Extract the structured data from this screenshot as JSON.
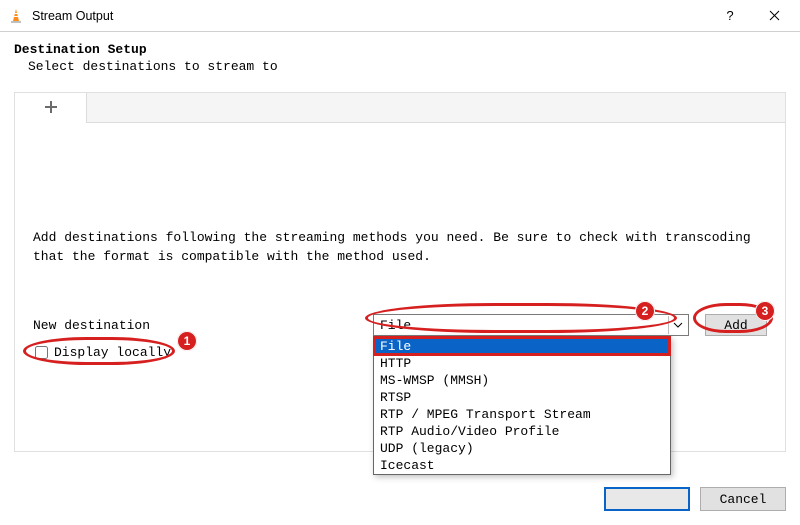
{
  "window": {
    "title": "Stream Output"
  },
  "header": {
    "title": "Destination Setup",
    "subtitle": "Select destinations to stream to"
  },
  "panel": {
    "instruction": "Add destinations following the streaming methods you need. Be sure to check with transcoding that the format is compatible with the method used.",
    "new_destination_label": "New destination",
    "combo_selected": "File",
    "add_label": "Add",
    "display_locally_label": "Display locally",
    "display_locally_checked": false
  },
  "dropdown_options": [
    "File",
    "HTTP",
    "MS-WMSP (MMSH)",
    "RTSP",
    "RTP / MPEG Transport Stream",
    "RTP Audio/Video Profile",
    "UDP (legacy)",
    "Icecast"
  ],
  "dropdown_selected_index": 0,
  "footer": {
    "next": "",
    "cancel": "Cancel"
  },
  "annotations": {
    "callout1": "1",
    "callout2": "2",
    "callout3": "3"
  }
}
